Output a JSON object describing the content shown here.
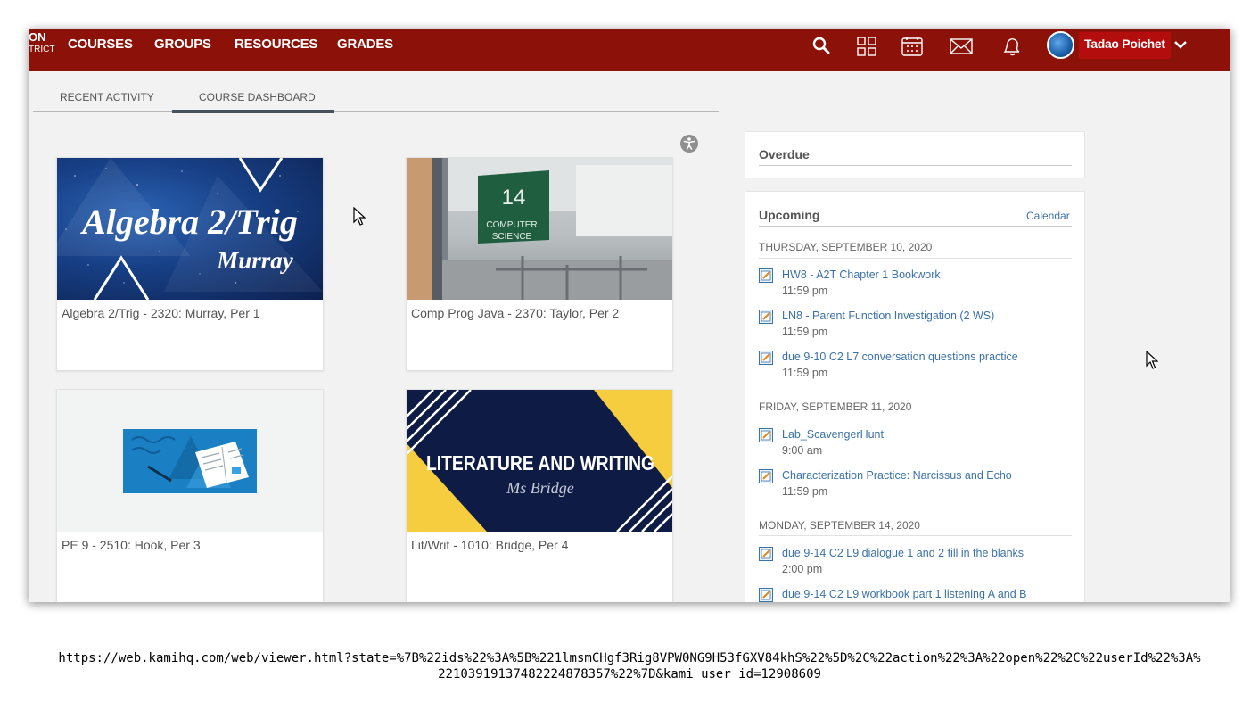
{
  "nav": {
    "logo_line1": "ON",
    "logo_line2": "TRICT",
    "links": [
      "COURSES",
      "GROUPS",
      "RESOURCES",
      "GRADES"
    ],
    "icons": [
      "search-icon",
      "apps-grid-icon",
      "calendar-icon",
      "mail-icon",
      "notifications-icon"
    ],
    "user_name": "Tadao Poichet",
    "brand_color": "#8c1108"
  },
  "tabs": {
    "recent": "RECENT ACTIVITY",
    "dashboard": "COURSE DASHBOARD",
    "active": "COURSE DASHBOARD"
  },
  "courses": [
    {
      "title": "Algebra 2/Trig - 2320: Murray, Per 1",
      "banner_line1": "Algebra 2/Trig",
      "banner_line2": "Murray"
    },
    {
      "title": "Comp Prog Java - 2370: Taylor, Per 2",
      "sign_number": "14",
      "sign_line1": "COMPUTER",
      "sign_line2": "SCIENCE"
    },
    {
      "title": "PE 9 - 2510: Hook, Per 3"
    },
    {
      "title": "Lit/Writ - 1010: Bridge, Per 4",
      "banner_line1": "LITERATURE AND WRITING",
      "banner_line2": "Ms Bridge"
    }
  ],
  "overdue": {
    "heading": "Overdue"
  },
  "upcoming": {
    "heading": "Upcoming",
    "calendar_link": "Calendar",
    "days": [
      {
        "label": "THURSDAY, SEPTEMBER 10, 2020",
        "items": [
          {
            "title": "HW8 - A2T Chapter 1 Bookwork",
            "time": "11:59 pm"
          },
          {
            "title": "LN8 - Parent Function Investigation (2 WS)",
            "time": "11:59 pm"
          },
          {
            "title": "due 9-10 C2 L7 conversation questions practice",
            "time": "11:59 pm"
          }
        ]
      },
      {
        "label": "FRIDAY, SEPTEMBER 11, 2020",
        "items": [
          {
            "title": "Lab_ScavengerHunt",
            "time": "9:00 am"
          },
          {
            "title": "Characterization Practice: Narcissus and Echo",
            "time": "11:59 pm"
          }
        ]
      },
      {
        "label": "MONDAY, SEPTEMBER 14, 2020",
        "items": [
          {
            "title": "due 9-14 C2 L9 dialogue 1 and 2 fill in the blanks",
            "time": "2:00 pm"
          },
          {
            "title": "due 9-14 C2 L9 workbook part 1 listening A and B",
            "time": ""
          }
        ]
      }
    ]
  },
  "url": {
    "line1": "https://web.kamihq.com/web/viewer.html?state=%7B%22ids%22%3A%5B%221lmsmCHgf3Rig8VPW0NG9H53fGXV84khS%22%5D%2C%22action%22%3A%22open%22%2C%22userId%22%3A%",
    "line2": "22103919137482224878357%22%7D&kami_user_id=12908609"
  }
}
